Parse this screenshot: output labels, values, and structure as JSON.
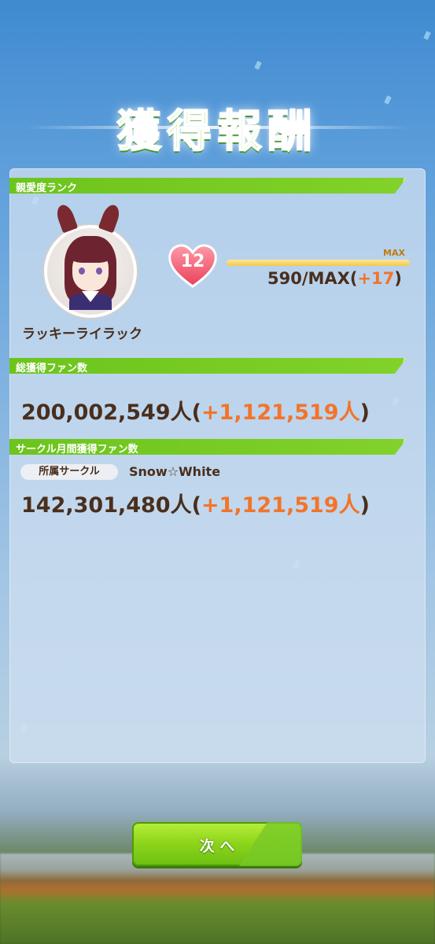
{
  "header": {
    "title": "獲得報酬"
  },
  "affinity": {
    "section_label": "親愛度ランク",
    "character_name": "ラッキーライラック",
    "rank": "12",
    "max_label": "MAX",
    "value_main": "590/MAX(",
    "value_gain": "+17",
    "value_close": ")",
    "progress": 1.0
  },
  "total_fans": {
    "section_label": "総獲得ファン数",
    "count": "200,002,549人(",
    "gain": "+1,121,519人",
    "close": ")"
  },
  "circle_fans": {
    "section_label": "サークル月間獲得ファン数",
    "tag": "所属サークル",
    "circle_name": "Snow☆White",
    "count": "142,301,480人(",
    "gain": "+1,121,519人",
    "close": ")"
  },
  "footer": {
    "next_label": "次 へ"
  },
  "colors": {
    "accent_green": "#6cc41c",
    "gain_orange": "#f2742a",
    "text_brown": "#4a2e1c"
  }
}
